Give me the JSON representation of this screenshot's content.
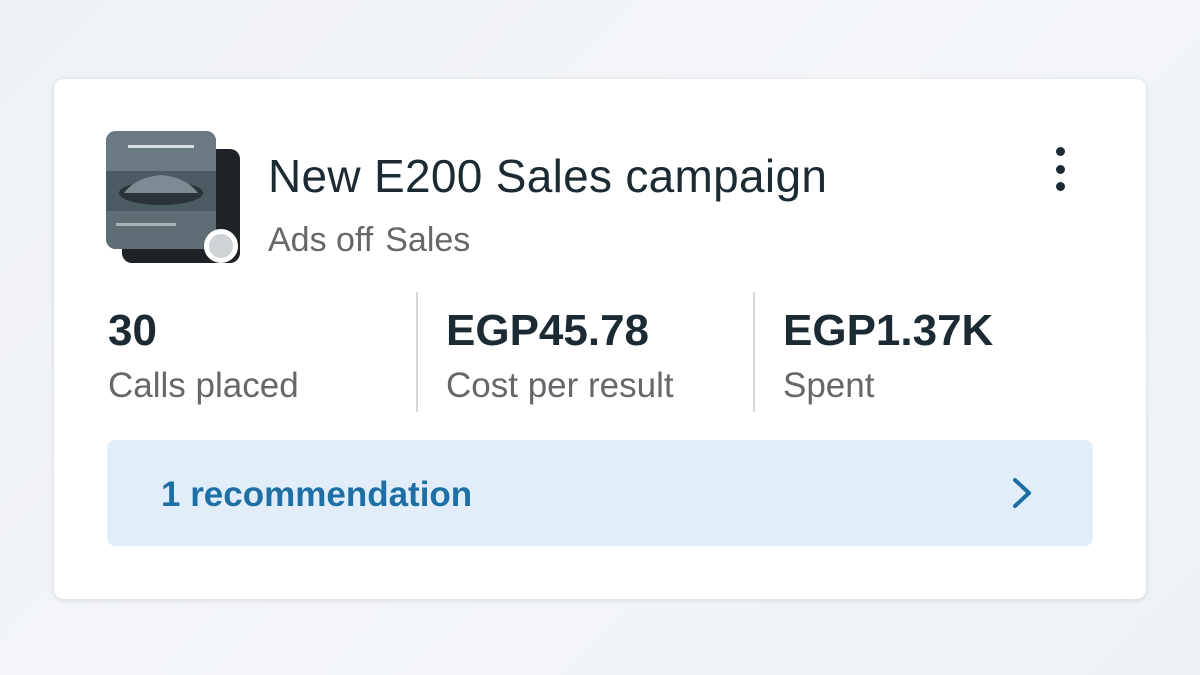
{
  "campaign": {
    "title": "New E200 Sales campaign",
    "status": "Ads off",
    "objective": "Sales",
    "thumbnail_icon": "ad-creative-thumbnail",
    "status_dot_color": "#cfd3d8"
  },
  "metrics": [
    {
      "value": "30",
      "label": "Calls placed"
    },
    {
      "value": "EGP45.78",
      "label": "Cost per result"
    },
    {
      "value": "EGP1.37K",
      "label": "Spent"
    }
  ],
  "recommendation": {
    "label": "1 recommendation",
    "icon": "chevron-right-icon"
  },
  "more_menu": {
    "icon": "more-vertical-icon"
  },
  "colors": {
    "accent": "#1d6fa5",
    "recommendation_bg": "#e1eef9",
    "text_primary": "#1c2b33",
    "text_secondary": "#65676b"
  }
}
